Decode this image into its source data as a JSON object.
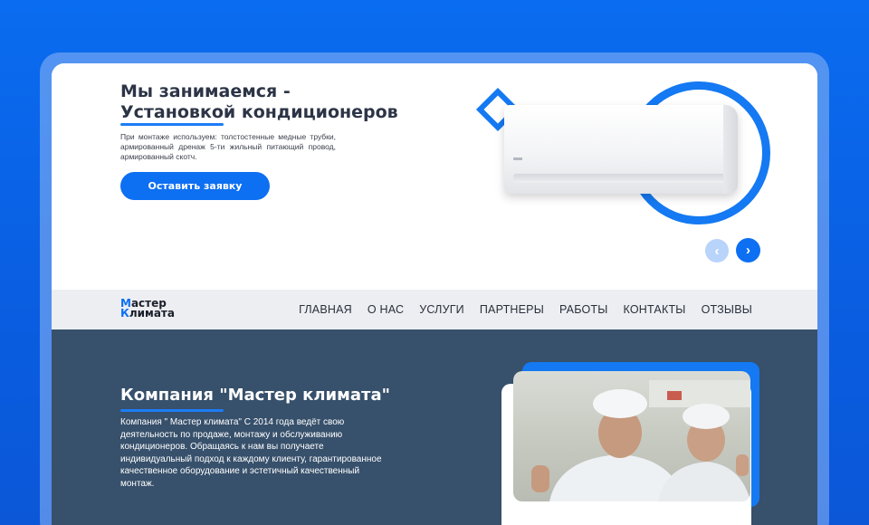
{
  "hero": {
    "title_line1": "Мы занимаемся -",
    "title_line2_accent": "Установкой",
    "title_line2_rest": " кондиционеров",
    "description": "При монтаже используем: толстостенные медные трубки, армированный дренаж 5-ти жильный питающий провод, армированный скотч.",
    "cta_label": "Оставить заявку",
    "prev_icon": "‹",
    "next_icon": "›"
  },
  "nav": {
    "brand_line1": "Мастер",
    "brand_line2": "Климата",
    "links": [
      "ГЛАВНАЯ",
      "О НАС",
      "УСЛУГИ",
      "ПАРТНЕРЫ",
      "РАБОТЫ",
      "КОНТАКТЫ",
      "ОТЗЫВЫ"
    ]
  },
  "about": {
    "title": "Компания \"Мастер климата\"",
    "text": "Компания \" Мастер климата\" С 2014 года ведёт свою деятельность по продаже, монтажу и обслуживанию кондиционеров. Обращаясь к нам вы получаете индивидуальный подход к каждому клиенту, гарантированное качественное оборудование и эстетичный качественный монтаж."
  },
  "colors": {
    "accent": "#0d6ff2",
    "about_bg": "#37506b",
    "nav_bg": "#eceef2"
  },
  "icons": {
    "prev": "chevron-left-icon",
    "next": "chevron-right-icon"
  }
}
